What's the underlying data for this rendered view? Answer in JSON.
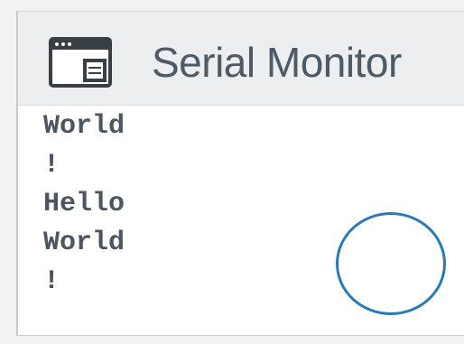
{
  "window": {
    "title": "Serial Monitor",
    "icon": "serial-monitor-window-icon"
  },
  "serial_output": {
    "lines": [
      "World",
      "!",
      "Hello",
      "World",
      "!"
    ]
  },
  "highlight": {
    "shape": "circle",
    "color": "#2a79b8"
  }
}
